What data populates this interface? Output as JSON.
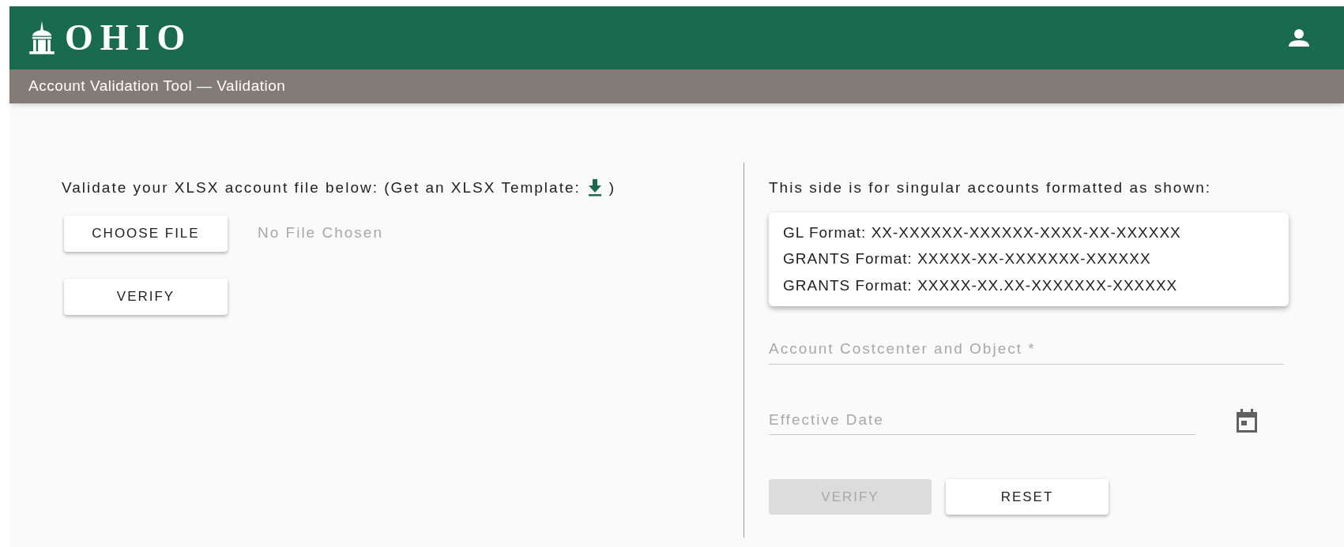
{
  "header": {
    "logo_text": "OHIO",
    "subtitle": "Account Validation Tool — Validation"
  },
  "file_panel": {
    "instruction": "Validate your XLSX account file below: (Get an XLSX Template:",
    "instruction_end": ")",
    "choose_button": "CHOOSE FILE",
    "file_status": "No File Chosen",
    "verify_button": {
      "label": "VERIFY",
      "disabled": false
    }
  },
  "single_panel": {
    "intro": "This side is for singular accounts formatted as shown:",
    "formats": [
      "GL Format: XX-XXXXXX-XXXXXX-XXXX-XX-XXXXXX",
      "GRANTS Format: XXXXX-XX-XXXXXXX-XXXXXX",
      "GRANTS Format: XXXXX-XX.XX-XXXXXXX-XXXXXX"
    ],
    "account_field": {
      "placeholder": "Account Costcenter and Object *"
    },
    "date_field": {
      "placeholder": "Effective Date"
    },
    "buttons": [
      {
        "label": "VERIFY",
        "disabled": true
      },
      {
        "label": "RESET",
        "disabled": false
      }
    ]
  }
}
